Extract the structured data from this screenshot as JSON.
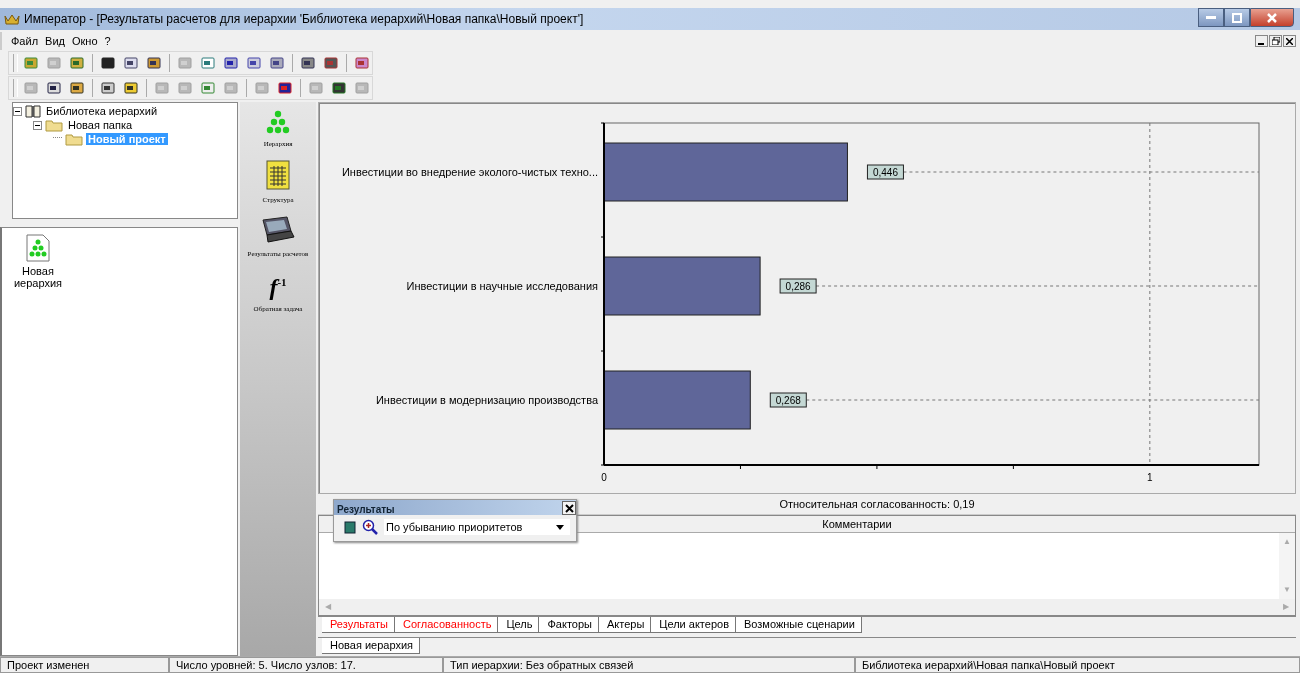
{
  "window": {
    "title": "Император - [Результаты расчетов для иерархии 'Библиотека иерархий\\Новая папка\\Новый проект']"
  },
  "menu": [
    "Файл",
    "Вид",
    "Окно",
    "?"
  ],
  "toolbars": [
    [
      {
        "disabled": false
      },
      {
        "disabled": true
      },
      {
        "disabled": false
      },
      {
        "disabled": false
      },
      {
        "disabled": false
      },
      {
        "disabled": false
      },
      {
        "disabled": true
      },
      {
        "disabled": false
      },
      {
        "disabled": false
      },
      {
        "disabled": false
      },
      {
        "disabled": false
      },
      {
        "disabled": false
      },
      {
        "disabled": false
      },
      {
        "disabled": false
      }
    ],
    [
      {
        "disabled": true
      },
      {
        "disabled": false
      },
      {
        "disabled": false
      },
      {
        "disabled": false
      },
      {
        "disabled": false
      },
      {
        "disabled": true
      },
      {
        "disabled": true
      },
      {
        "disabled": false
      },
      {
        "disabled": true
      },
      {
        "disabled": true
      },
      {
        "disabled": false
      },
      {
        "disabled": true
      },
      {
        "disabled": false
      },
      {
        "disabled": true
      }
    ]
  ],
  "tree": [
    {
      "label": "Библиотека иерархий",
      "expanded": true,
      "selected": false,
      "children": [
        {
          "label": "Новая папка",
          "expanded": true,
          "selected": false,
          "children": [
            {
              "label": "Новый проект",
              "selected": true
            }
          ]
        }
      ]
    }
  ],
  "files": [
    {
      "label": "Новая иерархия"
    }
  ],
  "sidebar": [
    {
      "kind": "hierarchy",
      "label": "Иерархия"
    },
    {
      "kind": "structure",
      "label": "Структура"
    },
    {
      "kind": "results",
      "label": "Результаты расчетов"
    },
    {
      "kind": "inverse",
      "label": "Обратная задача",
      "icon_text": "f",
      "icon_sup": "-1"
    }
  ],
  "chart": {
    "chart_data": {
      "type": "bar",
      "orientation": "horizontal",
      "categories": [
        "Инвестиции во внедрение эколого-чистых техно...",
        "Инвестиции в научные исследования",
        "Инвестиции в модернизацию производства"
      ],
      "values": [
        0.446,
        0.286,
        0.268
      ],
      "value_labels": [
        "0,446",
        "0,286",
        "0,268"
      ],
      "xlim": [
        0,
        1.2
      ],
      "xticks": [
        {
          "value": 0,
          "label": "0"
        },
        {
          "value": 1,
          "label": "1"
        }
      ]
    }
  },
  "consistency": "Относительная согласованность: 0,19",
  "comments_header": "Комментарии",
  "floating_toolbar": {
    "title": "Результаты",
    "sort": "По убыванию приоритетов"
  },
  "tabs": [
    {
      "label": "Результаты",
      "selected": true
    },
    {
      "label": "Согласованность",
      "selected": true
    },
    {
      "label": "Цель",
      "selected": false
    },
    {
      "label": "Факторы",
      "selected": false
    },
    {
      "label": "Актеры",
      "selected": false
    },
    {
      "label": "Цели актеров",
      "selected": false
    },
    {
      "label": "Возможные сценарии",
      "selected": false
    }
  ],
  "doc_tabs": [
    {
      "label": "Новая иерархия",
      "selected": true
    }
  ],
  "comments_scroll": {
    "up": "▲",
    "down": "▼",
    "left": "◀",
    "right": "▶"
  },
  "status_bar": [
    "Проект изменен",
    "Число уровней: 5. Число узлов: 17.",
    "Тип иерархии: Без обратных связей",
    "Библиотека иерархий\\Новая папка\\Новый проект"
  ]
}
